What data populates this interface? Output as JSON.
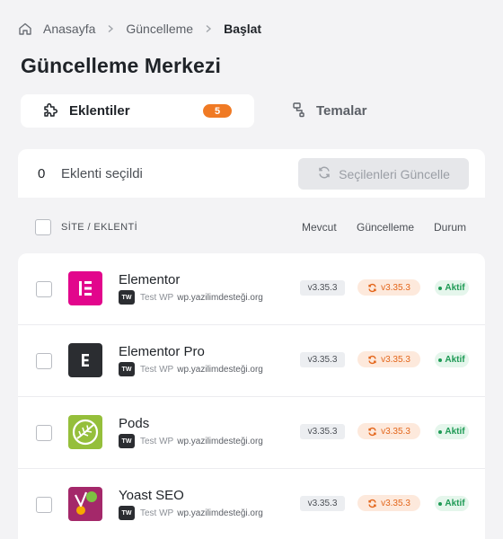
{
  "breadcrumb": {
    "home": "Anasayfa",
    "section": "Güncelleme",
    "current": "Başlat"
  },
  "page": {
    "title": "Güncelleme Merkezi"
  },
  "tabs": [
    {
      "label": "Eklentiler",
      "count": "5",
      "icon": "puzzle-icon",
      "active": true
    },
    {
      "label": "Temalar",
      "icon": "paint-roller-icon",
      "active": false
    }
  ],
  "selection": {
    "count": "0",
    "label": "Eklenti seçildi",
    "button": "Seçilenleri Güncelle"
  },
  "table": {
    "columns": {
      "site": "SİTE / EKLENTİ",
      "current": "Mevcut",
      "update": "Güncelleme",
      "status": "Durum"
    },
    "rows": [
      {
        "name": "Elementor",
        "logo": "elementor-logo",
        "site_icon": "TW",
        "site": "Test WP",
        "domain": "wp.yazilimdesteği.org",
        "current": "v3.35.3",
        "update": "v3.35.3",
        "status": "Aktif"
      },
      {
        "name": "Elementor Pro",
        "logo": "elementor-pro-logo",
        "site_icon": "TW",
        "site": "Test WP",
        "domain": "wp.yazilimdesteği.org",
        "current": "v3.35.3",
        "update": "v3.35.3",
        "status": "Aktif"
      },
      {
        "name": "Pods",
        "logo": "pods-logo",
        "site_icon": "TW",
        "site": "Test WP",
        "domain": "wp.yazilimdesteği.org",
        "current": "v3.35.3",
        "update": "v3.35.3",
        "status": "Aktif"
      },
      {
        "name": "Yoast SEO",
        "logo": "yoast-logo",
        "site_icon": "TW",
        "site": "Test WP",
        "domain": "wp.yazilimdesteği.org",
        "current": "v3.35.3",
        "update": "v3.35.3",
        "status": "Aktif"
      }
    ]
  },
  "colors": {
    "accent": "#f07a24",
    "active": "#1e9a55",
    "elementor": "#e2068c",
    "pods": "#95bf3b",
    "yoast": "#a4286a"
  }
}
